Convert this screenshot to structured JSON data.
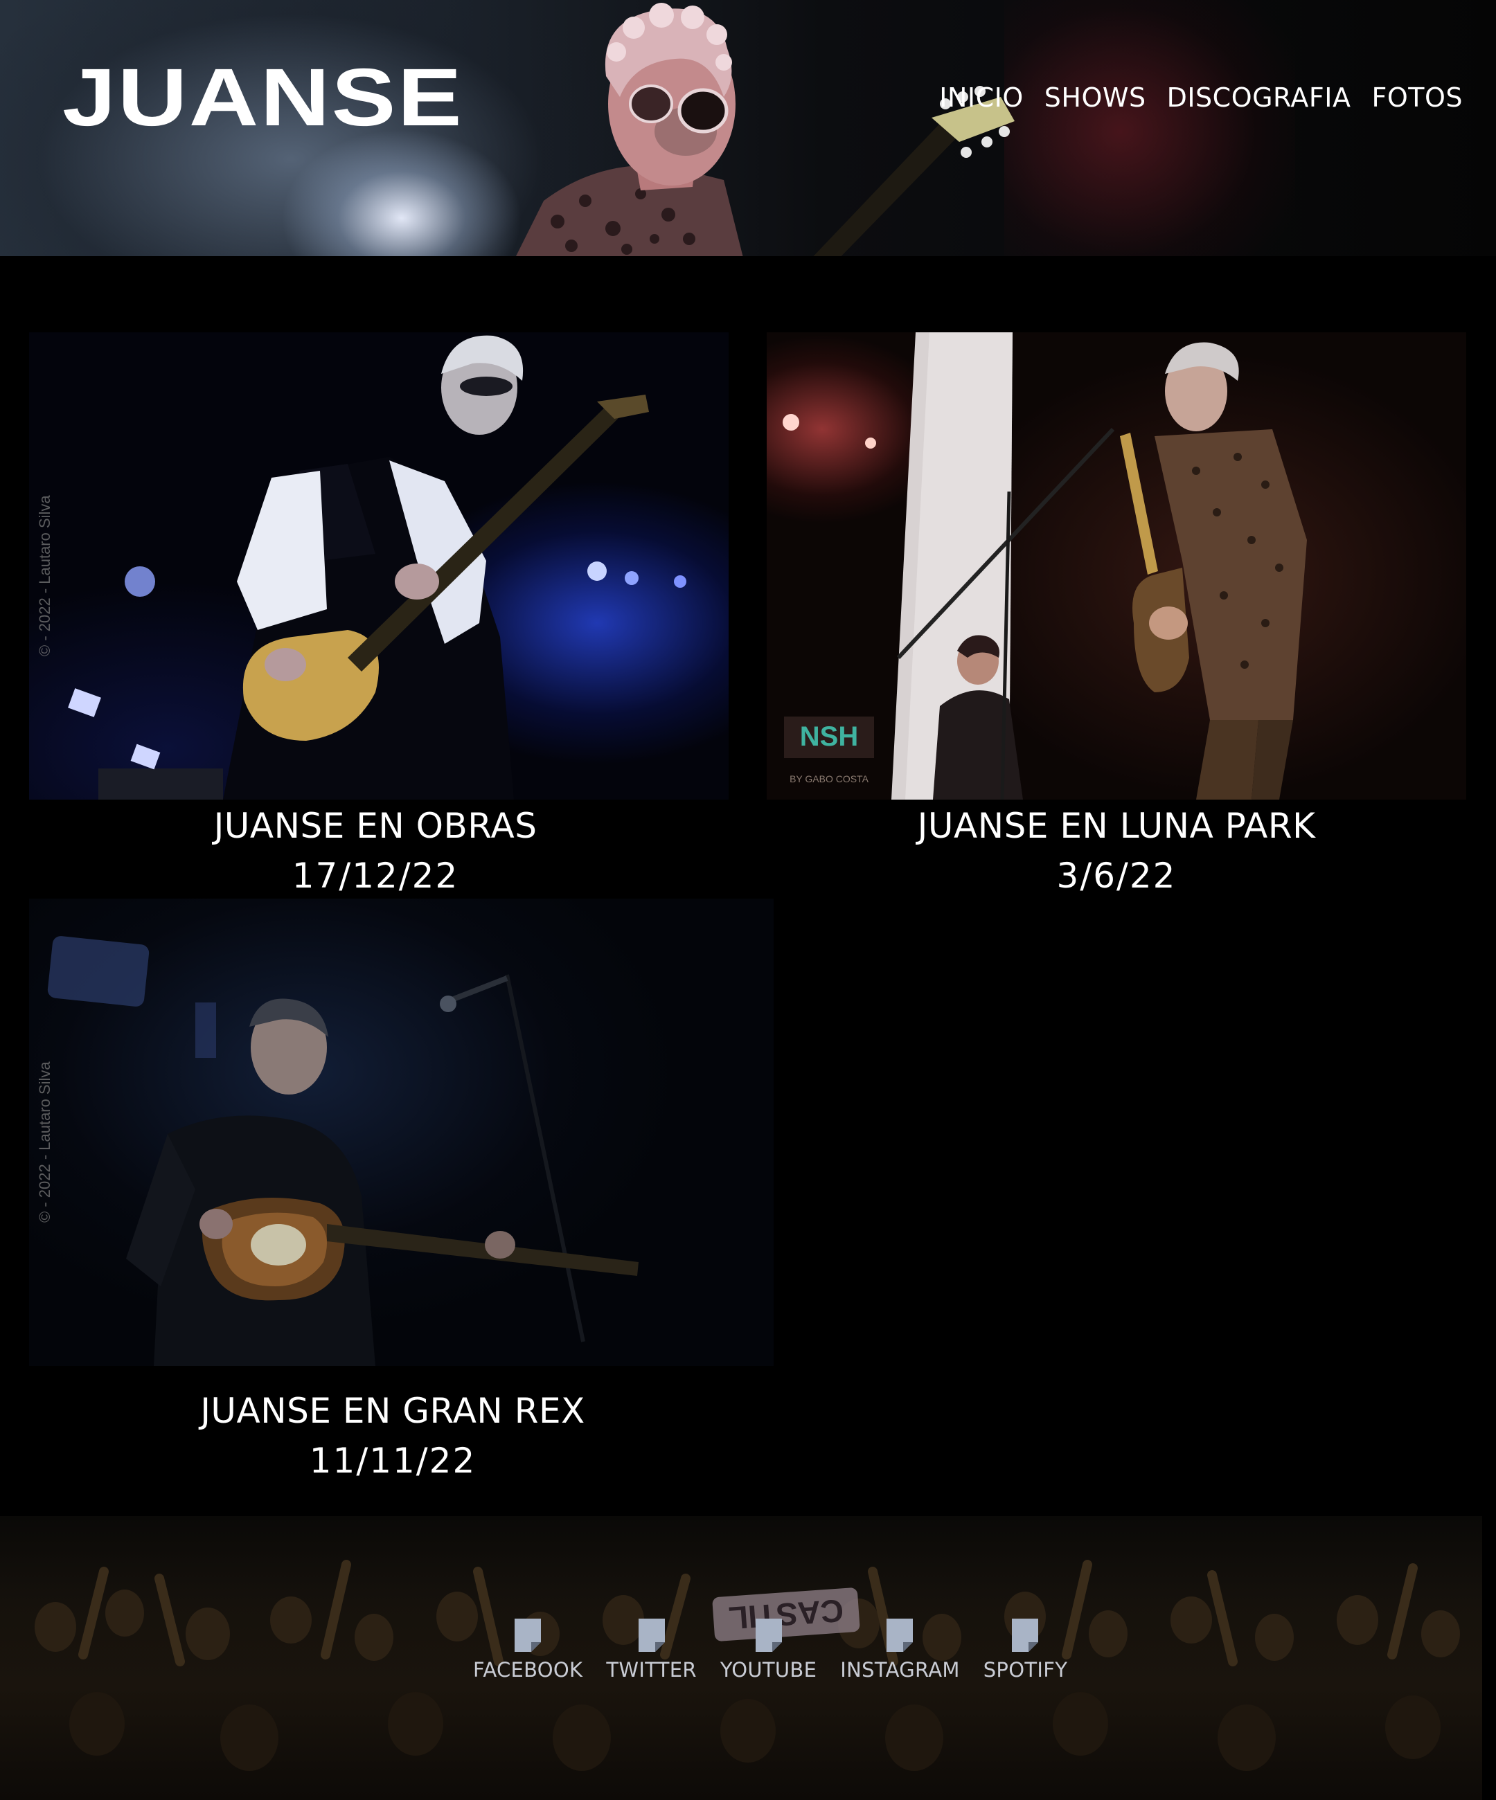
{
  "header": {
    "logo": "JUANSE",
    "nav": [
      "INICIO",
      "SHOWS",
      "DISCOGRAFIA",
      "FOTOS"
    ]
  },
  "gallery": [
    {
      "title": "JUANSE EN OBRAS",
      "date": "17/12/22",
      "watermark": "© - 2022 - Lautaro Silva"
    },
    {
      "title": "JUANSE EN LUNA PARK",
      "date": "3/6/22",
      "stage_sign": "NSH",
      "stage_sign_sub": "BY GABO COSTA"
    },
    {
      "title": "JUANSE EN GRAN REX",
      "date": "11/11/22",
      "watermark": "© - 2022 - Lautaro Silva"
    }
  ],
  "footer": {
    "banner": "CASTIL",
    "social": [
      {
        "label": "FACEBOOK",
        "icon": "file-icon"
      },
      {
        "label": "TWITTER",
        "icon": "file-icon"
      },
      {
        "label": "YOUTUBE",
        "icon": "file-icon"
      },
      {
        "label": "INSTAGRAM",
        "icon": "file-icon"
      },
      {
        "label": "SPOTIFY",
        "icon": "file-icon"
      }
    ]
  },
  "colors": {
    "background": "#000000",
    "text": "#ffffff",
    "social_text": "#c9ccd4",
    "icon": "#a9b4c6"
  }
}
